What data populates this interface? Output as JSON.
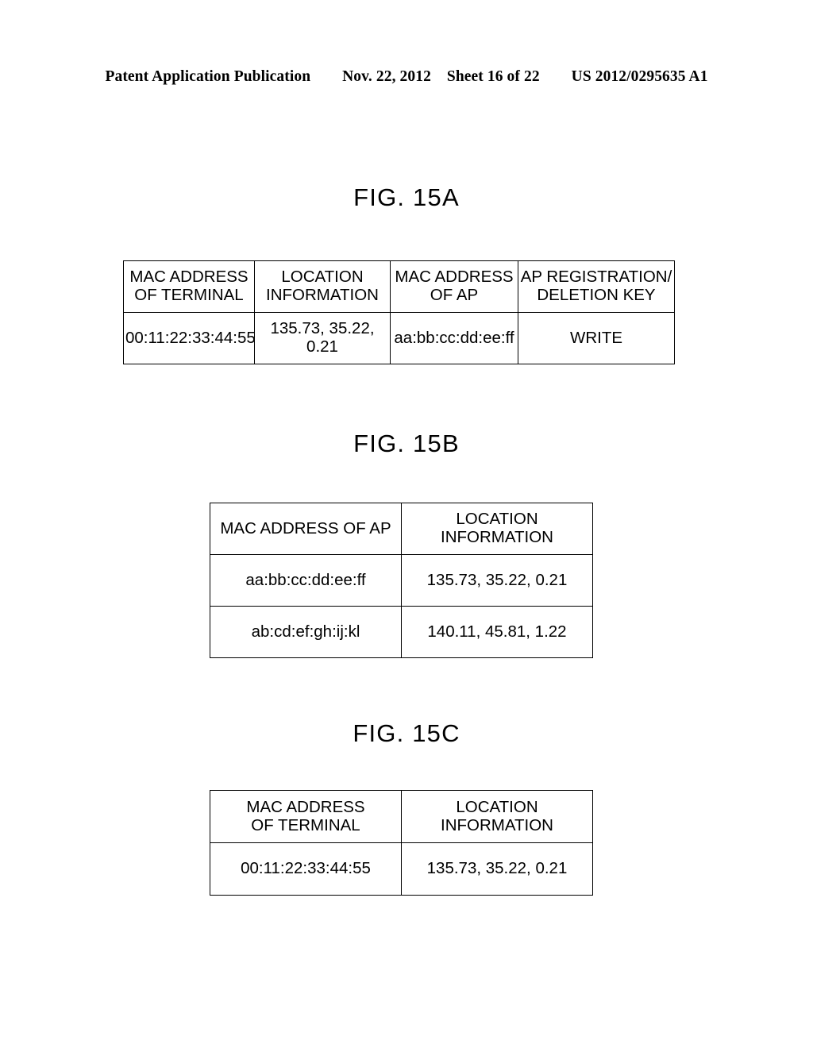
{
  "header": {
    "publication": "Patent Application Publication",
    "date": "Nov. 22, 2012",
    "sheet": "Sheet 16 of 22",
    "doc_number": "US 2012/0295635 A1"
  },
  "figures": [
    {
      "id": "15a",
      "title": "FIG. 15A",
      "columns": [
        {
          "line1": "MAC ADDRESS",
          "line2": "OF TERMINAL"
        },
        {
          "line1": "LOCATION",
          "line2": "INFORMATION"
        },
        {
          "line1": "MAC ADDRESS",
          "line2": "OF AP"
        },
        {
          "line1": "AP REGISTRATION/",
          "line2": "DELETION KEY"
        }
      ],
      "rows": [
        [
          "00:11:22:33:44:55",
          "135.73, 35.22, 0.21",
          "aa:bb:cc:dd:ee:ff",
          "WRITE"
        ]
      ]
    },
    {
      "id": "15b",
      "title": "FIG. 15B",
      "columns": [
        {
          "line1": "MAC ADDRESS OF AP",
          "line2": ""
        },
        {
          "line1": "LOCATION INFORMATION",
          "line2": ""
        }
      ],
      "rows": [
        [
          "aa:bb:cc:dd:ee:ff",
          "135.73, 35.22, 0.21"
        ],
        [
          "ab:cd:ef:gh:ij:kl",
          "140.11, 45.81, 1.22"
        ]
      ]
    },
    {
      "id": "15c",
      "title": "FIG. 15C",
      "columns": [
        {
          "line1": "MAC ADDRESS",
          "line2": "OF TERMINAL"
        },
        {
          "line1": "LOCATION INFORMATION",
          "line2": ""
        }
      ],
      "rows": [
        [
          "00:11:22:33:44:55",
          "135.73, 35.22, 0.21"
        ]
      ]
    }
  ],
  "colors": {
    "ink": "#000000",
    "paper": "#ffffff"
  }
}
